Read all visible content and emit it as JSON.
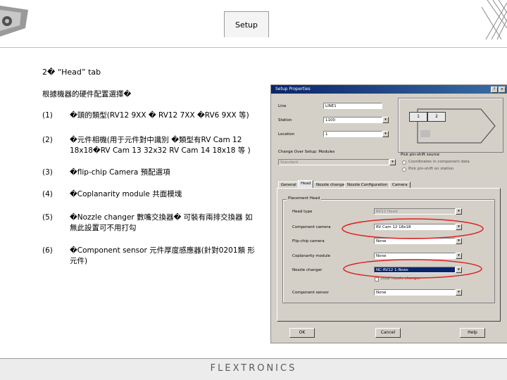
{
  "header": {
    "tab_label": "Setup"
  },
  "slide": {
    "title": "2� “Head” tab",
    "intro": "根據機器的硬件配置選擇�",
    "items": [
      {
        "num": "(1)",
        "text": "�頭的類型(RV12 9XX � RV12 7XX �RV6 9XX 等)"
      },
      {
        "num": "(2)",
        "text": "�元件相機(用于元件對中識別 �類型有RV Cam 12 18x18�RV Cam 13 32x32 RV Cam 14 18x18 等 )"
      },
      {
        "num": "(3)",
        "text": "�flip-chip Camera 預配選項"
      },
      {
        "num": "(4)",
        "text": "�Coplanarity module 共面模塊"
      },
      {
        "num": "(5)",
        "text": "�Nozzle changer 數嘴交換器� 可裝有兩排交換器 如無此設置可不用打勾"
      },
      {
        "num": "(6)",
        "text": "�Component sensor 元件厚度感應器(針對0201類 形元件)"
      }
    ]
  },
  "dialog": {
    "title": "Setup Properties",
    "title_buttons": [
      "?",
      "×"
    ],
    "fields": [
      {
        "label": "Line",
        "value": "LINE1"
      },
      {
        "label": "Station",
        "value": "1100"
      },
      {
        "label": "Location",
        "value": "1"
      }
    ],
    "station_diagram": {
      "box1": "1",
      "box2": "2"
    },
    "feeder_label": "Change Over Setup: Modules",
    "feeder_value": "Standard",
    "pick_group": {
      "title": "Pick pin-shift source",
      "options": [
        "Coordinates in component data",
        "Pick pin-shift on station"
      ]
    },
    "tabs": [
      "General",
      "Head",
      "Nozzle changer",
      "Nozzle Configuration",
      "Camera"
    ],
    "head_group": {
      "title": "Placement Head",
      "rows": [
        {
          "label": "Head type",
          "value": "RV12 Head"
        },
        {
          "label": "Component camera",
          "value": "RV Cam 12 18x18"
        },
        {
          "label": "Flip-chip camera",
          "value": "None"
        },
        {
          "label": "Coplanarity module",
          "value": "None"
        },
        {
          "label": "Nozzle changer",
          "value": "NC-RV12 1-Rows"
        },
        {
          "label": "Component sensor",
          "value": "None"
        }
      ],
      "checkbox_label": "Dual nozzle changer"
    },
    "buttons": {
      "ok": "OK",
      "cancel": "Cancel",
      "help": "Help"
    }
  },
  "footer": {
    "brand": "FLEXTRONICS"
  },
  "colors": {
    "highlight_ellipse": "#e02020",
    "title_bar": "#0a246a",
    "dialog_face": "#d4d0c8"
  }
}
